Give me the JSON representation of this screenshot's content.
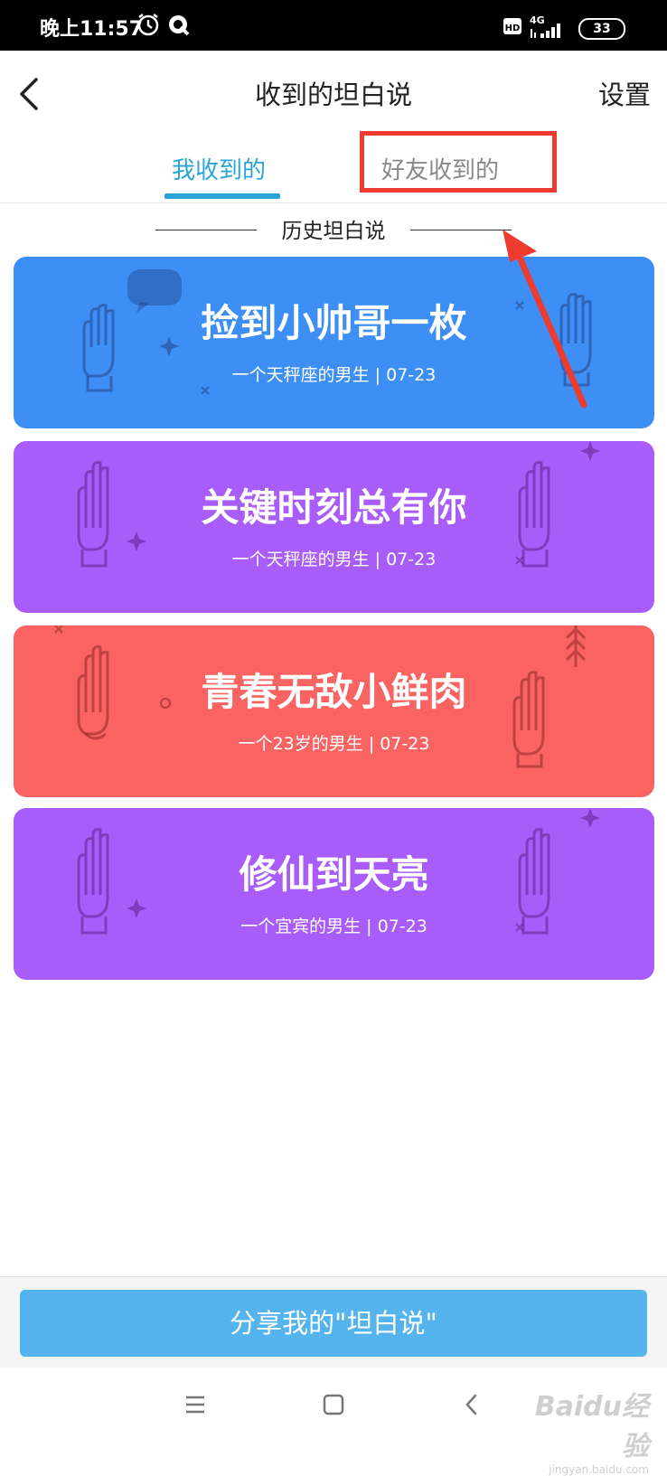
{
  "status_bar": {
    "time": "晚上11:57",
    "hd": "HD",
    "network": "4G",
    "battery": "33"
  },
  "header": {
    "title": "收到的坦白说",
    "settings": "设置"
  },
  "tabs": [
    {
      "label": "我收到的",
      "active": true
    },
    {
      "label": "好友收到的",
      "active": false
    }
  ],
  "section": {
    "title": "历史坦白说"
  },
  "cards": [
    {
      "title": "捡到小帅哥一枚",
      "subtitle": "一个天秤座的男生 | 07-23",
      "color": "#3d8ff5"
    },
    {
      "title": "关键时刻总有你",
      "subtitle": "一个天秤座的男生 | 07-23",
      "color": "#a85cfa"
    },
    {
      "title": "青春无敌小鲜肉",
      "subtitle": "一个23岁的男生 | 07-23",
      "color": "#f96462"
    },
    {
      "title": "修仙到天亮",
      "subtitle": "一个宜宾的男生 | 07-23",
      "color": "#a85cfa"
    }
  ],
  "share_button": {
    "label": "分享我的\"坦白说\""
  },
  "colors": {
    "accent": "#2aa4d8",
    "share": "#55b4ee",
    "annotation": "#ee3b30"
  },
  "watermark": {
    "text": "Baidu经验",
    "subtext": "jingyan.baidu.com"
  }
}
